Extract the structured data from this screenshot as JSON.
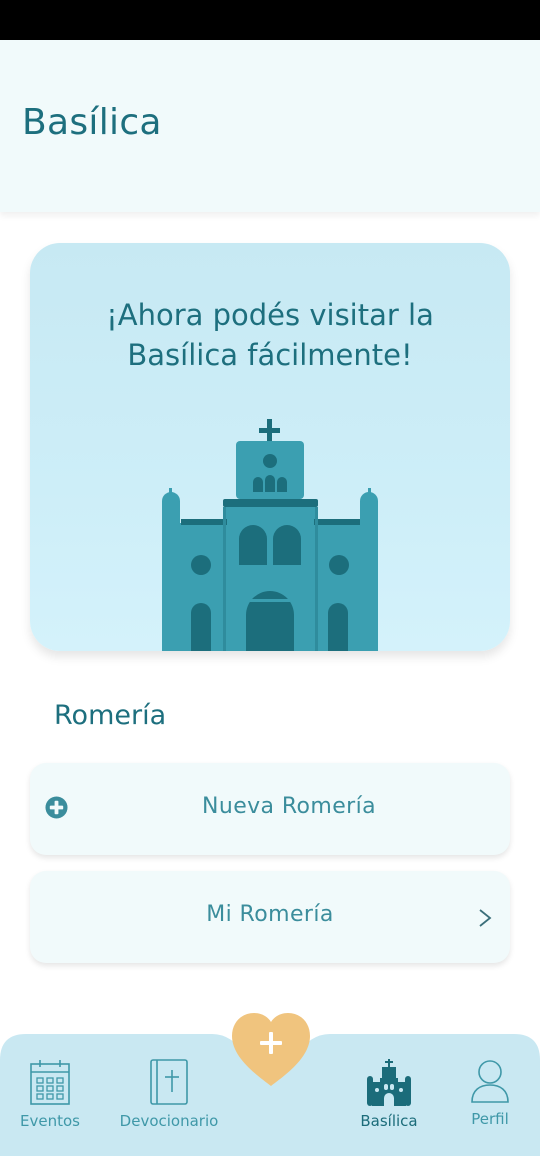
{
  "header": {
    "title": "Basílica"
  },
  "hero": {
    "line1": "¡Ahora podés visitar la",
    "line2": "Basílica fácilmente!"
  },
  "romeria": {
    "section_title": "Romería",
    "new_label": "Nueva Romería",
    "mine_label": "Mi Romería"
  },
  "nav": {
    "eventos": "Eventos",
    "devocionario": "Devocionario",
    "basilica": "Basílica",
    "perfil": "Perfil"
  },
  "colors": {
    "primary": "#1d6f7e",
    "accent": "#3f98a8",
    "fab": "#f0c47e",
    "nav_bg": "#c9e8f2"
  },
  "icons": [
    "plus-circle-icon",
    "chevron-right-icon",
    "calendar-icon",
    "bible-icon",
    "basilica-icon",
    "user-icon",
    "plus-icon",
    "heart-icon"
  ]
}
